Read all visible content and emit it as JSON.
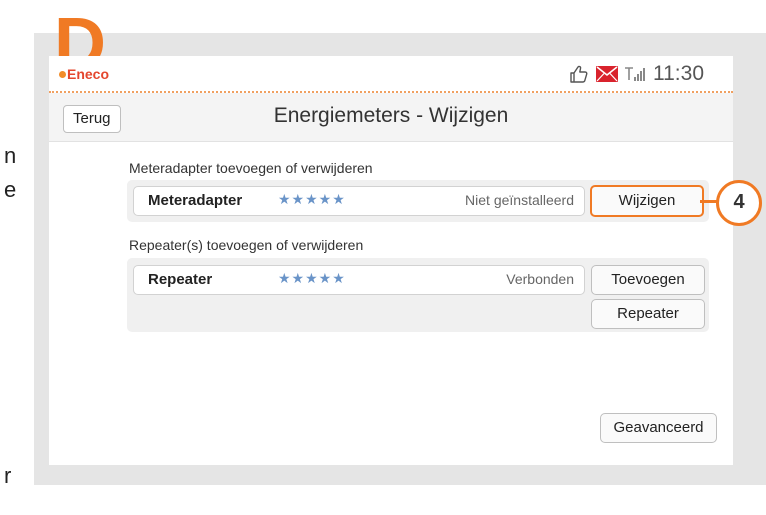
{
  "page": {
    "marker_letter": "D",
    "callout_number": "4",
    "edge_text": [
      "n",
      "e",
      "r"
    ]
  },
  "statusbar": {
    "brand": "Eneco",
    "time": "11:30",
    "icons": [
      "thumbs-up-icon",
      "mail-icon",
      "signal-icon"
    ]
  },
  "header": {
    "back_label": "Terug",
    "title": "Energiemeters - Wijzigen"
  },
  "meteradapter": {
    "section_label": "Meteradapter toevoegen of verwijderen",
    "name": "Meteradapter",
    "stars": "★★★★★",
    "status": "Niet geïnstalleerd",
    "button_label": "Wijzigen"
  },
  "repeater": {
    "section_label": "Repeater(s) toevoegen of verwijderen",
    "name": "Repeater",
    "stars": "★★★★★",
    "status": "Verbonden",
    "add_label": "Toevoegen",
    "second_label": "Repeater"
  },
  "footer": {
    "advanced_label": "Geavanceerd"
  },
  "colors": {
    "accent_orange": "#f07a24",
    "brand_red": "#e4472e",
    "star_blue": "#6a94c8",
    "mail_red": "#d9232d"
  }
}
